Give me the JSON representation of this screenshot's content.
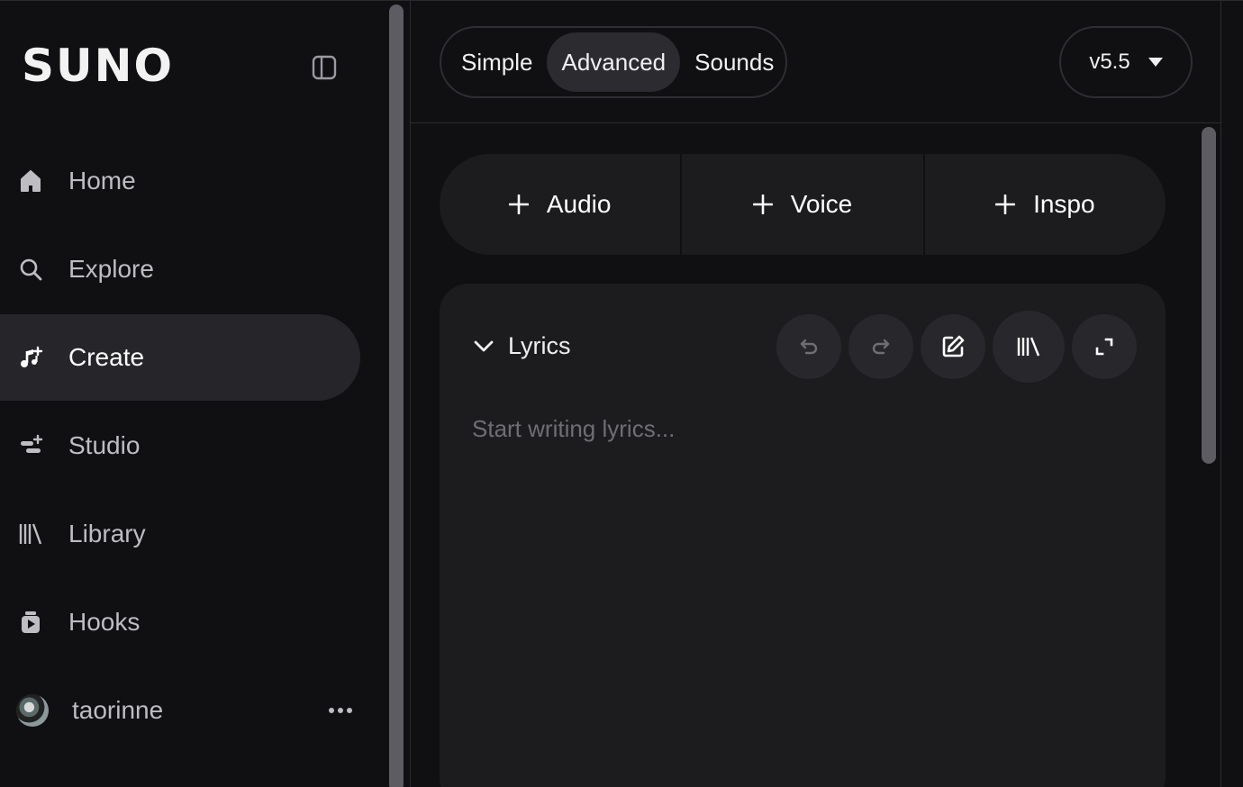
{
  "brand": {
    "logo": "SUNO"
  },
  "sidebar": {
    "items": [
      {
        "label": "Home",
        "icon": "home-icon"
      },
      {
        "label": "Explore",
        "icon": "search-icon"
      },
      {
        "label": "Create",
        "icon": "create-music-icon",
        "active": true
      },
      {
        "label": "Studio",
        "icon": "studio-icon"
      },
      {
        "label": "Library",
        "icon": "library-icon"
      },
      {
        "label": "Hooks",
        "icon": "hooks-icon"
      }
    ],
    "user": {
      "name": "taorinne"
    }
  },
  "modes": {
    "tabs": [
      "Simple",
      "Advanced",
      "Sounds"
    ],
    "active": "Advanced"
  },
  "version": {
    "value": "v5.5"
  },
  "add_buttons": [
    "Audio",
    "Voice",
    "Inspo"
  ],
  "lyrics": {
    "title": "Lyrics",
    "placeholder": "Start writing lyrics..."
  },
  "colors": {
    "background": "#101012",
    "panel": "#1c1c1f",
    "active_nav": "#26262a",
    "text": "#f0f0f0",
    "muted": "#bdbdc2"
  }
}
